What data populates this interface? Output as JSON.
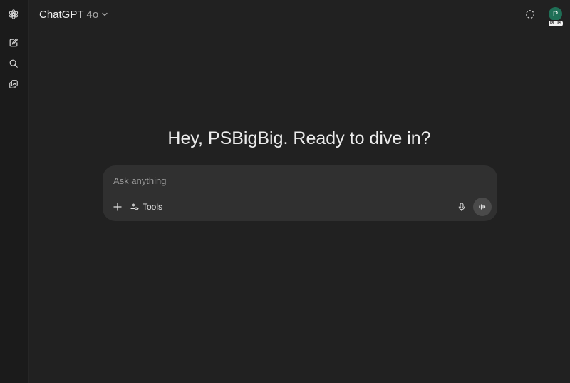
{
  "header": {
    "model_name": "ChatGPT",
    "model_version": "4o"
  },
  "user": {
    "avatar_initial": "P",
    "plan_badge": "PLUS"
  },
  "main": {
    "greeting": "Hey, PSBigBig. Ready to dive in?"
  },
  "composer": {
    "placeholder": "Ask anything",
    "tools_label": "Tools"
  },
  "icons": {
    "rail": [
      "openai-logo-icon",
      "new-chat-icon",
      "search-icon",
      "library-icon"
    ],
    "header_right": [
      "temporary-chat-icon"
    ],
    "composer": [
      "plus-icon",
      "tools-sliders-icon",
      "microphone-icon",
      "voice-mode-icon"
    ]
  },
  "colors": {
    "background": "#212121",
    "sidebar": "#1b1b1b",
    "composer": "#303030",
    "avatar": "#1f6f56",
    "voice_button": "#4a4a4a"
  }
}
